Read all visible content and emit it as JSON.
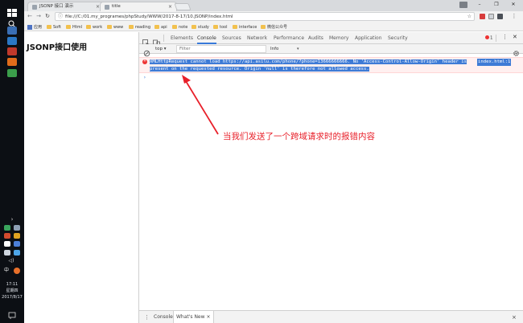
{
  "taskbar": {
    "clock_time": "17:11",
    "clock_day": "星期四",
    "clock_date": "2017/8/17"
  },
  "chrome": {
    "tabs": [
      {
        "title": "JSONP 接口 演示",
        "close": "×"
      },
      {
        "title": "title",
        "close": "×"
      }
    ],
    "address": "file:///C:/01.my_programes/phpStudy/WWW/2017-8-17/10.JSONP/index.html",
    "bookmarks": [
      {
        "label": "应用"
      },
      {
        "label": "Soft"
      },
      {
        "label": "Html"
      },
      {
        "label": "work"
      },
      {
        "label": "www"
      },
      {
        "label": "reading"
      },
      {
        "label": "api"
      },
      {
        "label": "note"
      },
      {
        "label": "study"
      },
      {
        "label": "tool"
      },
      {
        "label": "interface"
      },
      {
        "label": "微信公众号"
      }
    ]
  },
  "page": {
    "heading": "JSONP接口使用"
  },
  "devtools": {
    "tabs": [
      "Elements",
      "Console",
      "Sources",
      "Network",
      "Performance",
      "Audits",
      "Memory",
      "Application",
      "Security"
    ],
    "active_tab": "Console",
    "error_count": "1",
    "context": "top",
    "filter_placeholder": "Filter",
    "level": "Info",
    "message": {
      "line1": "XMLHttpRequest cannot load https://api.asilu.com/phone/?phone=13666666666. No 'Access-Control-Allow-Origin' header is",
      "line2": "present on the requested resource. Origin 'null' is therefore not allowed access.",
      "source": "index.html:1"
    },
    "prompt": "›",
    "annotation": "当我们发送了一个跨域请求时的报错内容",
    "drawer_tabs": [
      "Console",
      "What's New"
    ],
    "drawer_tab_close": "×",
    "drawer_close": "×"
  },
  "colors": {
    "accent": "#3879d9",
    "error": "#e33333",
    "annotation": "#e8202a",
    "selection": "#3e7bd6"
  }
}
